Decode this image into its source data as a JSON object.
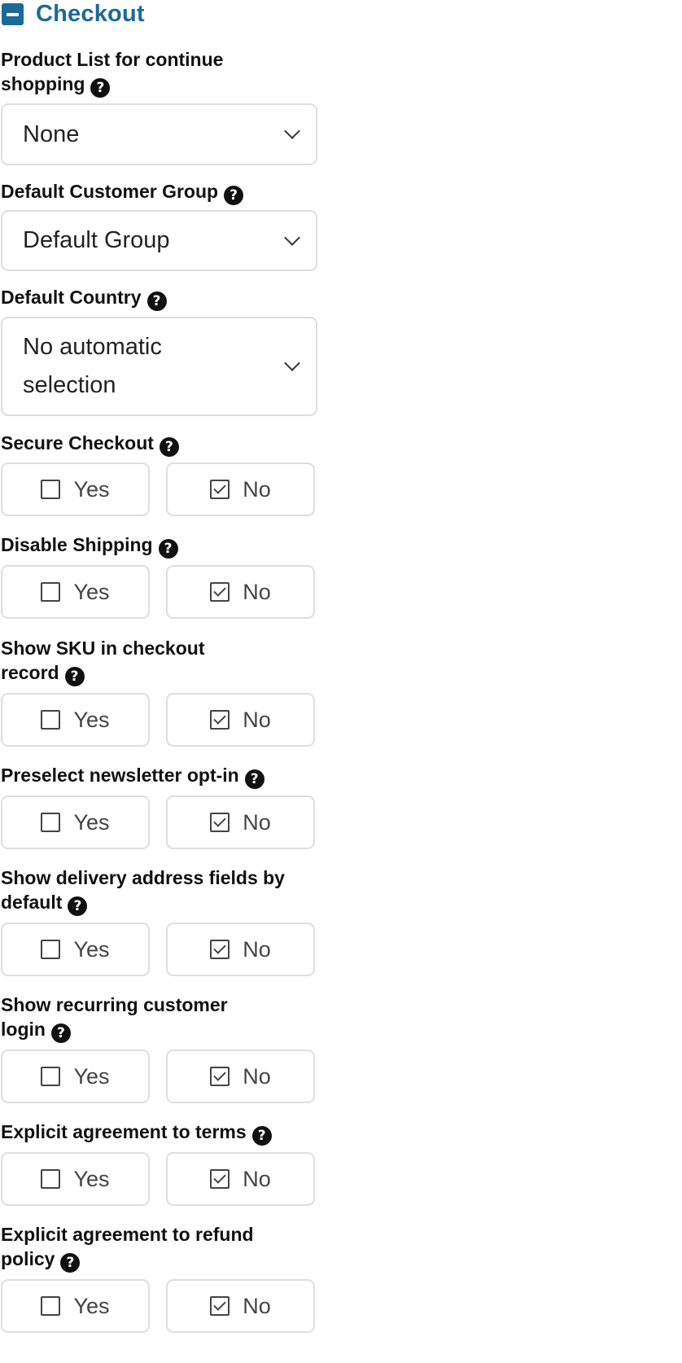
{
  "section": {
    "title": "Checkout"
  },
  "selects": [
    {
      "label": "Product List for continue shopping",
      "value": "None"
    },
    {
      "label": "Default Customer Group",
      "value": "Default Group"
    },
    {
      "label": "Default Country",
      "value": "No automatic selection"
    }
  ],
  "toggles": [
    {
      "label": "Secure Checkout",
      "yes_label": "Yes",
      "no_label": "No",
      "selected": "No"
    },
    {
      "label": "Disable Shipping",
      "yes_label": "Yes",
      "no_label": "No",
      "selected": "No"
    },
    {
      "label": "Show SKU in checkout record",
      "yes_label": "Yes",
      "no_label": "No",
      "selected": "No"
    },
    {
      "label": "Preselect newsletter opt-in",
      "yes_label": "Yes",
      "no_label": "No",
      "selected": "No"
    },
    {
      "label": "Show delivery address fields by default",
      "yes_label": "Yes",
      "no_label": "No",
      "selected": "No"
    },
    {
      "label": "Show recurring customer login",
      "yes_label": "Yes",
      "no_label": "No",
      "selected": "No"
    },
    {
      "label": "Explicit agreement to terms",
      "yes_label": "Yes",
      "no_label": "No",
      "selected": "No"
    },
    {
      "label": "Explicit agreement to refund policy",
      "yes_label": "Yes",
      "no_label": "No",
      "selected": "No"
    }
  ],
  "icons": {
    "help": "question-circle-icon",
    "collapse": "minus-square-icon",
    "dropdown": "chevron-down-icon",
    "unchecked": "square-icon",
    "checked": "check-square-icon"
  },
  "colors": {
    "accent": "#1a6a99",
    "border": "#dedede",
    "label": "#111111",
    "option_text": "#444444"
  }
}
